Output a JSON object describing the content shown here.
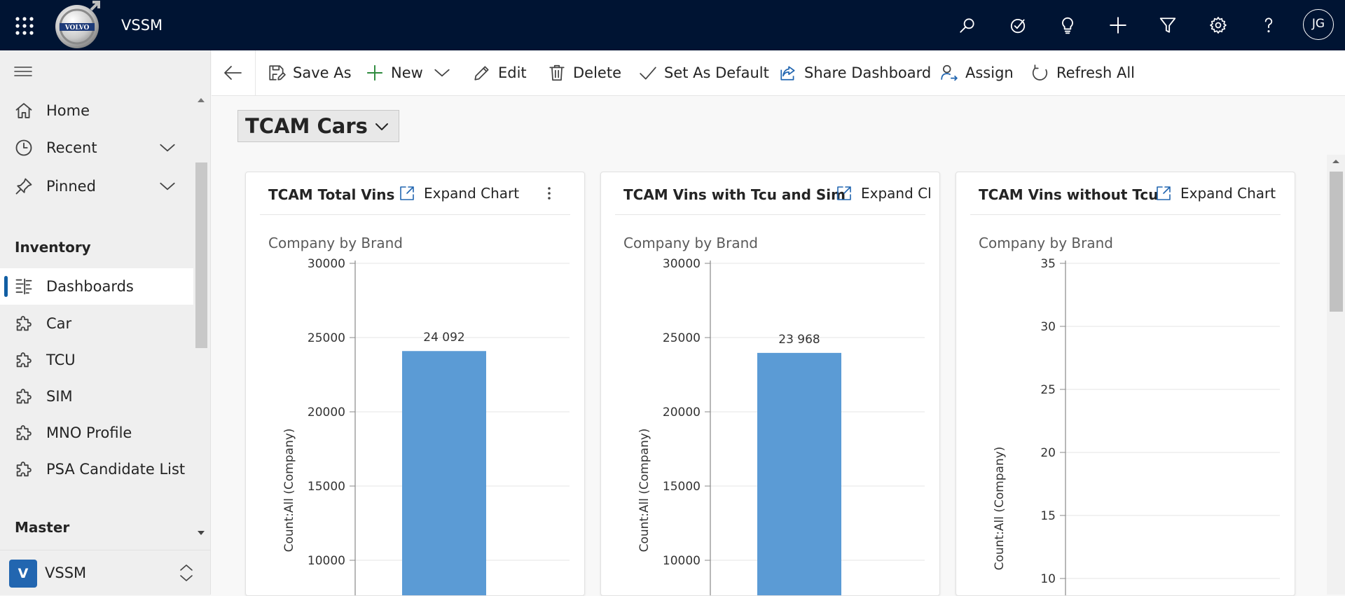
{
  "app": {
    "name": "VSSM",
    "logo_text": "VOLVO"
  },
  "topbar": {
    "icons": [
      "search-icon",
      "task-flow-icon",
      "lightbulb-icon",
      "plus-icon",
      "filter-icon",
      "settings-icon",
      "help-icon"
    ],
    "avatar_initials": "JG"
  },
  "sidebar": {
    "nav": [
      {
        "label": "Home",
        "icon": "home-icon"
      },
      {
        "label": "Recent",
        "icon": "clock-icon"
      },
      {
        "label": "Pinned",
        "icon": "pin-icon"
      }
    ],
    "sections": [
      {
        "title": "Inventory",
        "items": [
          {
            "label": "Dashboards",
            "icon": "dashboard-icon",
            "selected": true
          },
          {
            "label": "Car",
            "icon": "puzzle-icon"
          },
          {
            "label": "TCU",
            "icon": "puzzle-icon"
          },
          {
            "label": "SIM",
            "icon": "puzzle-icon"
          },
          {
            "label": "MNO Profile",
            "icon": "puzzle-icon"
          },
          {
            "label": "PSA Candidate List",
            "icon": "puzzle-icon"
          }
        ]
      },
      {
        "title": "Master",
        "items": []
      }
    ],
    "area": {
      "badge": "V",
      "label": "VSSM"
    }
  },
  "commandbar": {
    "save_as": "Save As",
    "new": "New",
    "edit": "Edit",
    "delete": "Delete",
    "set_default": "Set As Default",
    "share": "Share Dashboard",
    "assign": "Assign",
    "refresh": "Refresh All"
  },
  "dashboard": {
    "title": "TCAM Cars",
    "cards": [
      {
        "title": "TCAM Total Vins",
        "expand_label": "Expand Chart",
        "subtitle": "Company by Brand"
      },
      {
        "title": "TCAM Vins with Tcu and Sim",
        "expand_label": "Expand Cl",
        "subtitle": "Company by Brand"
      },
      {
        "title": "TCAM Vins without Tcu",
        "expand_label": "Expand Chart",
        "subtitle": "Company by Brand"
      }
    ]
  },
  "chart_data": [
    {
      "type": "bar",
      "title": "TCAM Total Vins",
      "subtitle": "Company by Brand",
      "ylabel": "Count:All (Company)",
      "yticks": [
        10000,
        15000,
        20000,
        25000,
        30000
      ],
      "ylim": [
        10000,
        30000
      ],
      "values": [
        24092
      ],
      "value_labels": [
        "24 092"
      ],
      "grid": true,
      "bar_color": "#5b9bd5"
    },
    {
      "type": "bar",
      "title": "TCAM Vins with Tcu and Sim",
      "subtitle": "Company by Brand",
      "ylabel": "Count:All (Company)",
      "yticks": [
        10000,
        15000,
        20000,
        25000,
        30000
      ],
      "ylim": [
        10000,
        30000
      ],
      "values": [
        23968
      ],
      "value_labels": [
        "23 968"
      ],
      "grid": true,
      "bar_color": "#5b9bd5"
    },
    {
      "type": "bar",
      "title": "TCAM Vins without Tcu",
      "subtitle": "Company by Brand",
      "ylabel": "Count:All (Company)",
      "yticks": [
        10,
        15,
        20,
        25,
        30,
        35
      ],
      "ylim": [
        10,
        35
      ],
      "values": [],
      "value_labels": [],
      "grid": true,
      "bar_color": "#5b9bd5"
    }
  ]
}
